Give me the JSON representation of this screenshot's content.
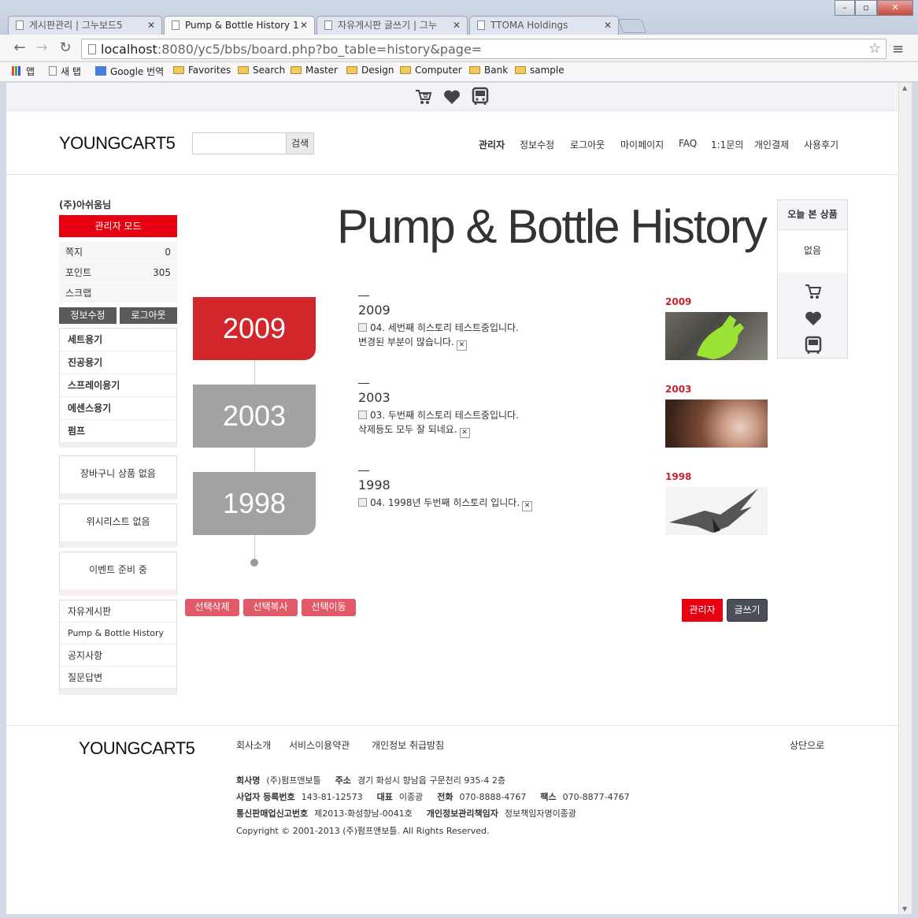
{
  "browser": {
    "tabs": [
      {
        "title": "게시판관리 | 그누보드5"
      },
      {
        "title": "Pump & Bottle History 1"
      },
      {
        "title": "자유게시판 글쓰기 | 그누"
      },
      {
        "title": "TTOMA Holdings"
      }
    ],
    "url_host": "localhost",
    "url_rest": ":8080/yc5/bbs/board.php?bo_table=history&page=",
    "bookmarks": [
      "앱",
      "새 탭",
      "Google 번역",
      "Favorites",
      "Search",
      "Master",
      "Design",
      "Computer",
      "Bank",
      "sample"
    ]
  },
  "site": {
    "logo": "YOUNGCART5",
    "search_button": "검색",
    "search_placeholder": "",
    "nav": [
      "관리자",
      "정보수정",
      "로그아웃",
      "마이페이지",
      "FAQ",
      "1:1문의",
      "개인결제",
      "사용후기"
    ]
  },
  "sidebar": {
    "user": "(주)아쉬움님",
    "admin_mode": "관리자 모드",
    "stats": [
      {
        "label": "쪽지",
        "value": "0"
      },
      {
        "label": "포인트",
        "value": "305"
      },
      {
        "label": "스크랩",
        "value": ""
      }
    ],
    "edit_button": "정보수정",
    "logout_button": "로그아웃",
    "categories": [
      "세트용기",
      "진공용기",
      "스프레이용기",
      "에센스용기",
      "펌프"
    ],
    "cart_empty": "장바구니 상품 없음",
    "wish_empty": "위시리스트 없음",
    "event": "이벤트 준비 중",
    "boards": [
      "자유게시판",
      "Pump & Bottle History",
      "공지사항",
      "질문답변"
    ]
  },
  "board": {
    "title": "Pump & Bottle History",
    "entries": [
      {
        "year": "2009",
        "title": "2009",
        "lines": [
          "04. 세번째 히스토리 테스트중입니다.",
          "변경된 부분이 많습니다."
        ]
      },
      {
        "year": "2003",
        "title": "2003",
        "lines": [
          "03. 두번째 히스토리 테스트중입니다.",
          "삭제등도 모두 잘 되네요."
        ]
      },
      {
        "year": "1998",
        "title": "1998",
        "lines": [
          "04. 1998년 두번째 히스토리 입니다."
        ]
      }
    ],
    "actions": [
      "선택삭제",
      "선택복사",
      "선택이동"
    ],
    "admin_button": "관리자",
    "write_button": "글쓰기"
  },
  "recent": {
    "title": "오늘 본 상품",
    "empty": "없음"
  },
  "footer": {
    "logo": "YOUNGCART5",
    "links": [
      "회사소개",
      "서비스이용약관",
      "개인정보 취급방침"
    ],
    "top": "상단으로",
    "company_label": "회사명",
    "company": "(주)펌프앤보틀",
    "address_label": "주소",
    "address": "경기 화성시 향남읍 구문천리 935-4 2층",
    "bizno_label": "사업자 등록번호",
    "bizno": "143-81-12573",
    "ceo_label": "대표",
    "ceo": "이종광",
    "tel_label": "전화",
    "tel": "070-8888-4767",
    "fax_label": "팩스",
    "fax": "070-8877-4767",
    "mail_label": "통신판매업신고번호",
    "mail": "제2013-화성향남-0041호",
    "privacy_label": "개인정보관리책임자",
    "privacy": "정보책임자명이종광",
    "copyright": "Copyright © 2001-2013 (주)펌프앤보틀. All Rights Reserved."
  },
  "colors": {
    "accent": "#e60012",
    "timeline_red": "#d0262c",
    "timeline_gray": "#a2a2a2",
    "button_pink": "#e05a68",
    "button_dark": "#4a4f58"
  }
}
